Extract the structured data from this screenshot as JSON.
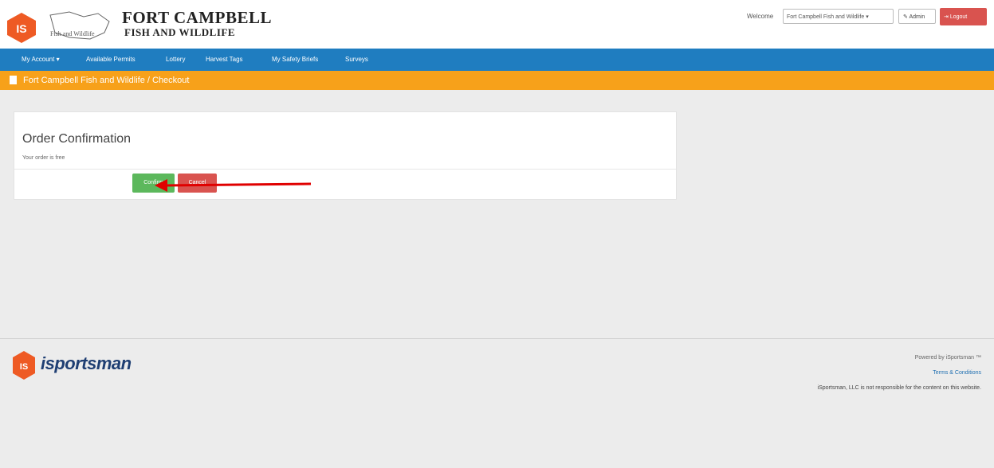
{
  "header": {
    "logo_mark": "IS",
    "fw_logo_text": "Fish and Wildlife",
    "title": "FORT CAMPBELL",
    "subtitle": "FISH AND WILDLIFE",
    "welcome_label": "Welcome",
    "user_dropdown": "Fort Campbell Fish and Wildlife ▾",
    "admin_label": "Admin",
    "logout_label": "Logout"
  },
  "nav": {
    "items": [
      "My Account ▾",
      "Available Permits",
      "Lottery",
      "Harvest Tags",
      "My Safety Briefs",
      "Surveys"
    ]
  },
  "breadcrumb": {
    "text": "Fort Campbell Fish and Wildlife / Checkout"
  },
  "order": {
    "title": "Order Confirmation",
    "message": "Your order is free",
    "confirm_label": "Confirm",
    "cancel_label": "Cancel"
  },
  "footer": {
    "brand": "isportsman",
    "powered_by": "Powered by iSportsman ™",
    "terms": "Terms & Conditions",
    "disclaimer": "iSportsman, LLC is not responsible for the content on this website."
  },
  "colors": {
    "nav_blue": "#1f7dc0",
    "breadcrumb_orange": "#f7a11a",
    "brand_orange": "#ee5a24",
    "confirm_green": "#5cb85c",
    "cancel_red": "#d9534f",
    "annotation_arrow": "#e00000"
  }
}
